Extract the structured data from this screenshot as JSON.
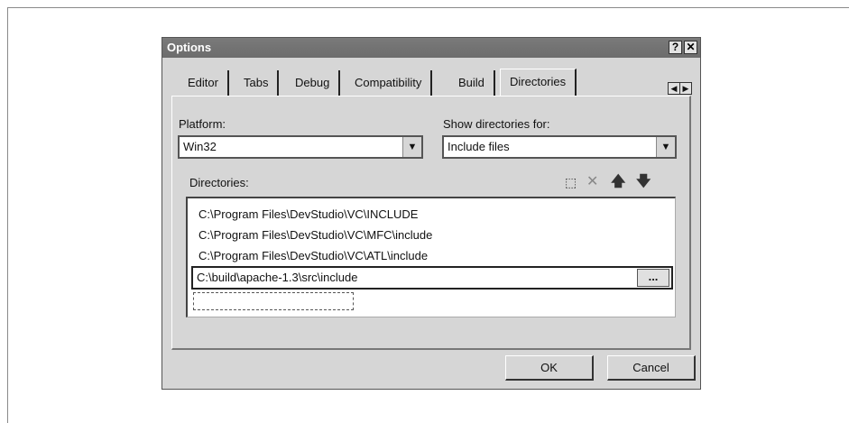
{
  "dialog": {
    "title": "Options",
    "help_label": "?",
    "close_label": "✕"
  },
  "tabs": [
    {
      "label": "Editor"
    },
    {
      "label": "Tabs"
    },
    {
      "label": "Debug"
    },
    {
      "label": "Compatibility"
    },
    {
      "label": "Build"
    },
    {
      "label": "Directories",
      "active": true
    }
  ],
  "tab_scroll": {
    "left_label": "◀",
    "right_label": "▶"
  },
  "platform": {
    "label": "Platform:",
    "value": "Win32"
  },
  "show_dirs_for": {
    "label": "Show directories for:",
    "value": "Include files"
  },
  "directories": {
    "label": "Directories:",
    "toolbar_icons": [
      "new-folder-icon",
      "delete-icon",
      "move-up-icon",
      "move-down-icon"
    ],
    "items": [
      "C:\\Program Files\\DevStudio\\VC\\INCLUDE",
      "C:\\Program Files\\DevStudio\\VC\\MFC\\include",
      "C:\\Program Files\\DevStudio\\VC\\ATL\\include"
    ],
    "editing_value": "C:\\build\\apache-1.3\\src\\include",
    "browse_label": "..."
  },
  "buttons": {
    "ok_label": "OK",
    "cancel_label": "Cancel"
  }
}
